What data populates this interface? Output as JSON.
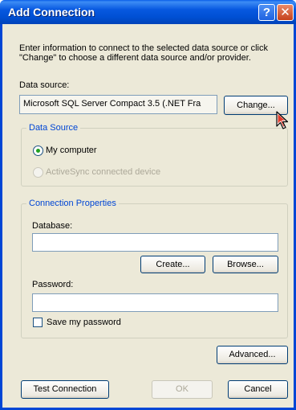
{
  "window": {
    "title": "Add Connection",
    "help_glyph": "?",
    "close_glyph": "✕"
  },
  "intro_text": "Enter information to connect to the selected data source or click \"Change\" to choose a different data source and/or provider.",
  "data_source": {
    "label": "Data source:",
    "value": "Microsoft SQL Server Compact 3.5 (.NET Fra",
    "change_button": "Change..."
  },
  "data_source_group": {
    "legend": "Data Source",
    "options": [
      {
        "label": "My computer",
        "selected": true,
        "enabled": true
      },
      {
        "label": "ActiveSync connected device",
        "selected": false,
        "enabled": false
      }
    ]
  },
  "connection_properties": {
    "legend": "Connection Properties",
    "database_label": "Database:",
    "database_value": "",
    "create_button": "Create...",
    "browse_button": "Browse...",
    "password_label": "Password:",
    "password_value": "",
    "save_password_label": "Save my password",
    "save_password_checked": false
  },
  "buttons": {
    "advanced": "Advanced...",
    "test_connection": "Test Connection",
    "ok": "OK",
    "cancel": "Cancel"
  },
  "colors": {
    "titlebar": "#0050d4",
    "dialog_bg": "#ece9d8",
    "group_legend": "#0046d5",
    "radio_selected": "#21a121"
  },
  "icons": {
    "cursor": "mouse-pointer-icon"
  }
}
